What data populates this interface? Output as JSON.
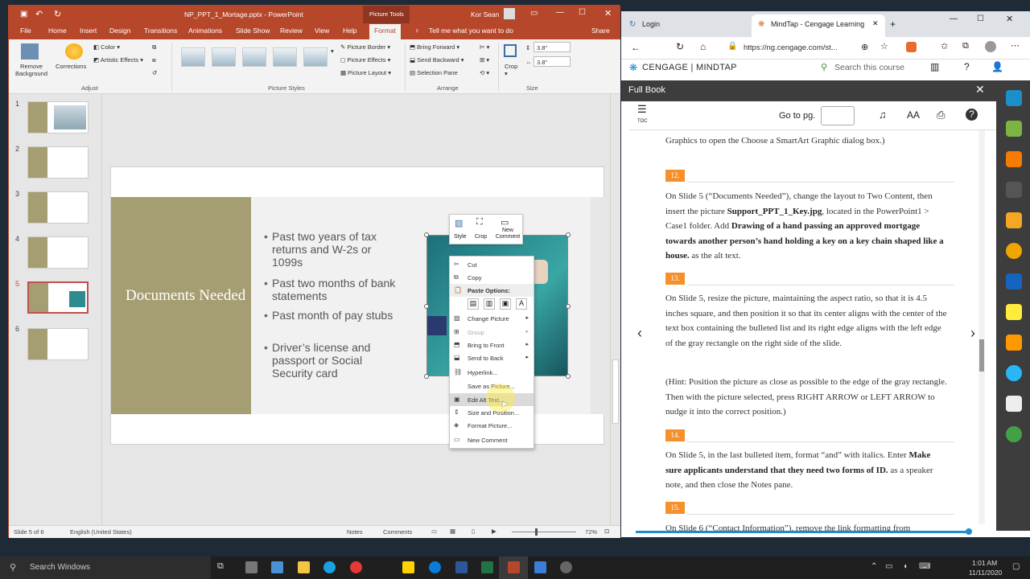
{
  "ppt": {
    "filename": "NP_PPT_1_Mortage.pptx - PowerPoint",
    "tools_label": "Picture Tools",
    "user": "Kor Sean",
    "tabs": [
      "File",
      "Home",
      "Insert",
      "Design",
      "Transitions",
      "Animations",
      "Slide Show",
      "Review",
      "View",
      "Help",
      "Format"
    ],
    "tell_me": "Tell me what you want to do",
    "share": "Share",
    "ribbon": {
      "remove_bg": "Remove Background",
      "corrections": "Corrections",
      "color": "Color",
      "artistic": "Artistic Effects",
      "adjust": "Adjust",
      "picture_styles": "Picture Styles",
      "border": "Picture Border",
      "effects": "Picture Effects",
      "layout": "Picture Layout",
      "bring_forward": "Bring Forward",
      "send_backward": "Send Backward",
      "selection_pane": "Selection Pane",
      "arrange": "Arrange",
      "crop": "Crop",
      "height": "3.8\"",
      "width": "3.8\"",
      "size": "Size"
    },
    "slide_numbers": [
      "1",
      "2",
      "3",
      "4",
      "5",
      "6"
    ],
    "selected_slide": 5,
    "slide": {
      "title": "Documents Needed",
      "bullets": [
        "Past two years of tax returns and W-2s or 1099s",
        "Past two months of bank statements",
        "Past month of pay stubs",
        "Driver’s license and passport or Social Security card"
      ]
    },
    "mini_toolbar": {
      "style": "Style",
      "crop": "Crop",
      "new_comment": "New Comment"
    },
    "context_menu": [
      {
        "label": "Cut",
        "state": "normal"
      },
      {
        "label": "Copy",
        "state": "normal"
      },
      {
        "label": "Paste Options:",
        "state": "header"
      },
      {
        "label": "Change Picture",
        "state": "sub"
      },
      {
        "label": "Group",
        "state": "disabled"
      },
      {
        "label": "Bring to Front",
        "state": "sub"
      },
      {
        "label": "Send to Back",
        "state": "sub"
      },
      {
        "label": "Hyperlink...",
        "state": "normal"
      },
      {
        "label": "Save as Picture...",
        "state": "normal"
      },
      {
        "label": "Edit Alt Text...",
        "state": "highlight"
      },
      {
        "label": "Size and Position...",
        "state": "normal"
      },
      {
        "label": "Format Picture...",
        "state": "normal"
      },
      {
        "label": "New Comment",
        "state": "normal"
      }
    ],
    "status": {
      "slide": "Slide 5 of 6",
      "language": "English (United States)",
      "notes": "Notes",
      "comments": "Comments",
      "zoom": "72%"
    }
  },
  "browser": {
    "tab1": "Login",
    "tab2": "MindTap - Cengage Learning",
    "url": "https://ng.cengage.com/st...",
    "brand": "CENGAGE | MINDTAP",
    "search_placeholder": "Search this course",
    "panel_title": "Full Book",
    "goto": "Go to pg.",
    "toc": "TOC",
    "text_size": "AA"
  },
  "steps": [
    {
      "num": "12.",
      "text": "On Slide 5 (“Documents Needed”), change the layout to Two Content, then insert the picture <b>Support_PPT_1_Key.jpg</b>, located in the PowerPoint1 > Case1 folder. Add <b>Drawing of a hand passing an approved mortgage towards another person’s hand holding a key on a key chain shaped like a house.</b> as the alt text."
    },
    {
      "num": "13.",
      "text": "On Slide 5, resize the picture, maintaining the aspect ratio, so that it is 4.5 inches square, and then position it so that its center aligns with the center of the text box containing the bulleted list and its right edge aligns with the left edge of the gray rectangle on the right side of the slide."
    },
    {
      "num": "14.",
      "text": "On Slide 5, in the last bulleted item, format “and” with italics. Enter <b>Make sure applicants understand that they need two forms of ID.</b> as a speaker note, and then close the Notes pane."
    },
    {
      "num": "15.",
      "text": "On Slide 6 (“Contact Information”), remove the link formatting from"
    }
  ],
  "top_fragment": "Graphics to open the Choose a SmartArt Graphic dialog box.)",
  "hint": "(Hint: Position the picture as close as possible to the edge of the gray rectangle. Then with the picture selected, press RIGHT ARROW or LEFT ARROW to nudge it into the correct position.)",
  "taskbar": {
    "search": "Search Windows",
    "time": "1:01 AM",
    "date": "11/11/2020"
  }
}
